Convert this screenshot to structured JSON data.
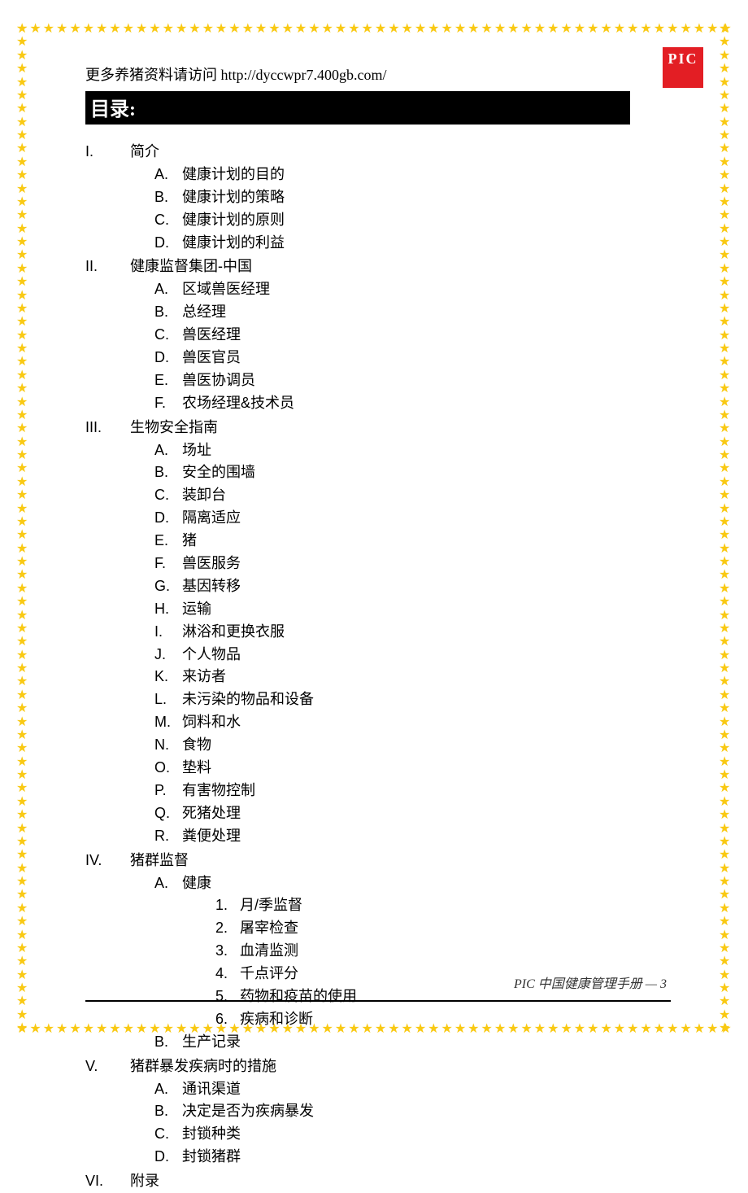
{
  "logo": "PIC",
  "header_link": "更多养猪资料请访问 http://dyccwpr7.400gb.com/",
  "toc_title": "目录:",
  "footer": "PIC 中国健康管理手册 — 3",
  "sections": [
    {
      "num": "I.",
      "title": "简介",
      "children": [
        {
          "num": "A.",
          "title": "健康计划的目的"
        },
        {
          "num": "B.",
          "title": "健康计划的策略"
        },
        {
          "num": "C.",
          "title": "健康计划的原则"
        },
        {
          "num": "D.",
          "title": "健康计划的利益"
        }
      ]
    },
    {
      "num": "II.",
      "title": "健康监督集团-中国",
      "children": [
        {
          "num": "A.",
          "title": "区域兽医经理"
        },
        {
          "num": "B.",
          "title": "总经理"
        },
        {
          "num": "C.",
          "title": "兽医经理"
        },
        {
          "num": "D.",
          "title": "兽医官员"
        },
        {
          "num": "E.",
          "title": "兽医协调员"
        },
        {
          "num": "F.",
          "title": "农场经理&技术员"
        }
      ]
    },
    {
      "num": "III.",
      "title": "生物安全指南",
      "children": [
        {
          "num": "A.",
          "title": "场址"
        },
        {
          "num": "B.",
          "title": "安全的围墙"
        },
        {
          "num": "C.",
          "title": "装卸台"
        },
        {
          "num": "D.",
          "title": "隔离适应"
        },
        {
          "num": "E.",
          "title": "猪"
        },
        {
          "num": "F.",
          "title": "兽医服务"
        },
        {
          "num": "G.",
          "title": "基因转移"
        },
        {
          "num": "H.",
          "title": "运输"
        },
        {
          "num": "I.",
          "title": "淋浴和更换衣服"
        },
        {
          "num": "J.",
          "title": "个人物品"
        },
        {
          "num": "K.",
          "title": "来访者"
        },
        {
          "num": "L.",
          "title": "未污染的物品和设备"
        },
        {
          "num": "M.",
          "title": "饲料和水"
        },
        {
          "num": "N.",
          "title": "食物"
        },
        {
          "num": "O.",
          "title": "垫料"
        },
        {
          "num": "P.",
          "title": "有害物控制"
        },
        {
          "num": "Q.",
          "title": "死猪处理"
        },
        {
          "num": "R.",
          "title": "粪便处理"
        }
      ]
    },
    {
      "num": "IV.",
      "title": "猪群监督",
      "children": [
        {
          "num": "A.",
          "title": "健康",
          "children": [
            {
              "num": "1.",
              "title": "月/季监督"
            },
            {
              "num": "2.",
              "title": "屠宰检查"
            },
            {
              "num": "3.",
              "title": "血清监测"
            },
            {
              "num": "4.",
              "title": "千点评分"
            },
            {
              "num": "5.",
              "title": "药物和疫苗的使用"
            },
            {
              "num": "6.",
              "title": "疾病和诊断"
            }
          ]
        },
        {
          "num": "B.",
          "title": "生产记录"
        }
      ]
    },
    {
      "num": "V.",
      "title": "猪群暴发疾病时的措施",
      "children": [
        {
          "num": "A.",
          "title": "通讯渠道"
        },
        {
          "num": "B.",
          "title": "决定是否为疾病暴发"
        },
        {
          "num": "C.",
          "title": "封锁种类"
        },
        {
          "num": "D.",
          "title": "封锁猪群"
        }
      ]
    },
    {
      "num": "VI.",
      "title": "附录",
      "children": []
    }
  ]
}
